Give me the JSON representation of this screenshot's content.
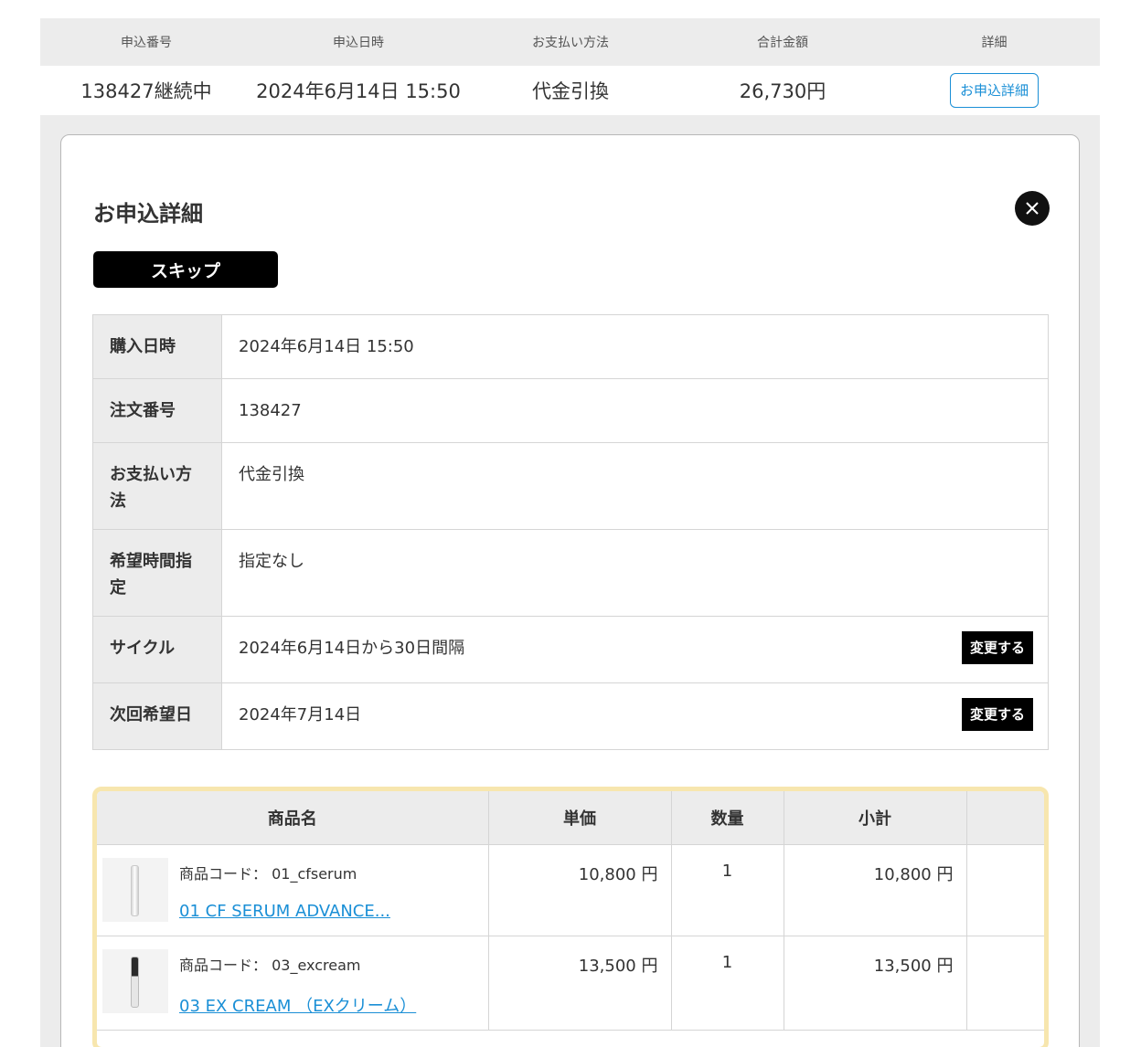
{
  "summary": {
    "headers": [
      "申込番号",
      "申込日時",
      "お支払い方法",
      "合計金額",
      "詳細"
    ],
    "row": {
      "order_no": "138427継続中",
      "order_datetime": "2024年6月14日 15:50",
      "payment": "代金引換",
      "total": "26,730円",
      "detail_button": "お申込詳細"
    }
  },
  "modal": {
    "title": "お申込詳細",
    "close_icon": "×",
    "skip_button": "スキップ",
    "info": [
      {
        "label": "購入日時",
        "value": "2024年6月14日 15:50"
      },
      {
        "label": "注文番号",
        "value": "138427"
      },
      {
        "label": "お支払い方法",
        "value": "代金引換"
      },
      {
        "label": "希望時間指定",
        "value": "指定なし"
      },
      {
        "label": "サイクル",
        "value": "2024年6月14日から30日間隔",
        "button": "変更する"
      },
      {
        "label": "次回希望日",
        "value": "2024年7月14日",
        "button": "変更する"
      }
    ],
    "products": {
      "headers": [
        "商品名",
        "単価",
        "数量",
        "小計",
        ""
      ],
      "rows": [
        {
          "code": "商品コード： 01_cfserum",
          "name": "01 CF SERUM ADVANCE...",
          "unit_price": "10,800 円",
          "qty": "1",
          "subtotal": "10,800 円"
        },
        {
          "code": "商品コード： 03_excream",
          "name": "03 EX CREAM （EXクリーム）",
          "unit_price": "13,500 円",
          "qty": "1",
          "subtotal": "13,500 円"
        }
      ]
    }
  },
  "colors": {
    "accent": "#1a8fd6",
    "highlight_border": "#f7e6ae"
  }
}
